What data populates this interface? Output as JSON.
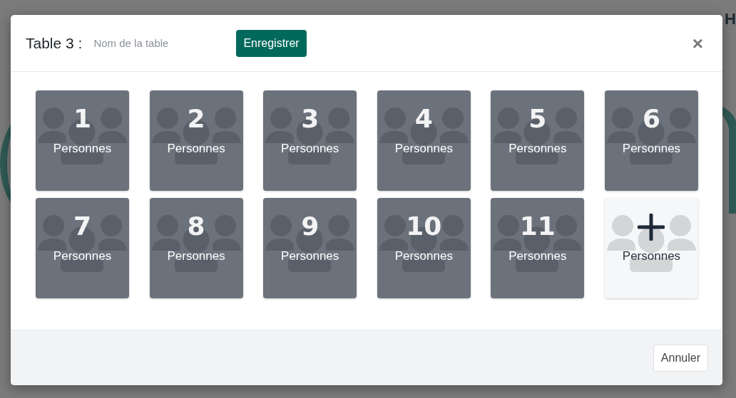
{
  "background": {
    "header_text": "H"
  },
  "modal": {
    "title": "Table 3 :",
    "name_field": {
      "placeholder": "Nom de la table"
    },
    "save_button": "Enregistrer",
    "close": "×",
    "tiles": [
      {
        "kind": "count",
        "number": "1",
        "label": "Personnes"
      },
      {
        "kind": "count",
        "number": "2",
        "label": "Personnes"
      },
      {
        "kind": "count",
        "number": "3",
        "label": "Personnes"
      },
      {
        "kind": "count",
        "number": "4",
        "label": "Personnes"
      },
      {
        "kind": "count",
        "number": "5",
        "label": "Personnes"
      },
      {
        "kind": "count",
        "number": "6",
        "label": "Personnes"
      },
      {
        "kind": "count",
        "number": "7",
        "label": "Personnes"
      },
      {
        "kind": "count",
        "number": "8",
        "label": "Personnes"
      },
      {
        "kind": "count",
        "number": "9",
        "label": "Personnes"
      },
      {
        "kind": "count",
        "number": "10",
        "label": "Personnes"
      },
      {
        "kind": "count",
        "number": "11",
        "label": "Personnes"
      },
      {
        "kind": "add",
        "label": "Personnes"
      }
    ],
    "cancel_button": "Annuler"
  }
}
